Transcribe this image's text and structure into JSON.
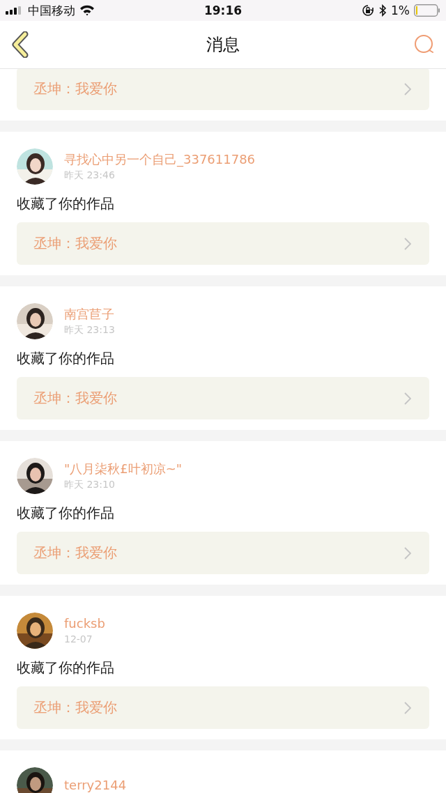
{
  "status_bar": {
    "carrier": "中国移动",
    "time": "19:16",
    "battery": "1%"
  },
  "nav": {
    "title": "消息"
  },
  "top_partial": {
    "quote": "丞坤：我爱你"
  },
  "messages": [
    {
      "user": "寻找心中另一个自己_337611786",
      "time": "昨天 23:46",
      "action": "收藏了你的作品",
      "quote": "丞坤：我爱你"
    },
    {
      "user": "南宫苣子",
      "time": "昨天 23:13",
      "action": "收藏了你的作品",
      "quote": "丞坤：我爱你"
    },
    {
      "user": "\"八月柒秋£叶初凉~\"",
      "time": "昨天 23:10",
      "action": "收藏了你的作品",
      "quote": "丞坤：我爱你"
    },
    {
      "user": "fucksb",
      "time": "12-07",
      "action": "收藏了你的作品",
      "quote": "丞坤：我爱你"
    },
    {
      "user": "terry2144"
    }
  ]
}
